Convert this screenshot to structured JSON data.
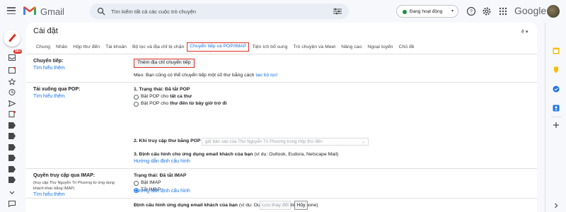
{
  "app": {
    "name": "Gmail",
    "search_placeholder": "Tìm kiếm tất cả các cuộc trò chuyện",
    "status": "Đang hoạt động",
    "account_brand": "Google",
    "inbox_badge": "99+"
  },
  "settings": {
    "title": "Cài đặt",
    "lang_icon": "ê",
    "tabs": [
      {
        "label": "Chung"
      },
      {
        "label": "Nhãn"
      },
      {
        "label": "Hộp thư đến"
      },
      {
        "label": "Tài khoản"
      },
      {
        "label": "Bộ lọc và địa chỉ bị chặn"
      },
      {
        "label": "Chuyển tiếp và POP/IMAP",
        "active": true
      },
      {
        "label": "Tiện ích bổ sung"
      },
      {
        "label": "Trò chuyện và Meet"
      },
      {
        "label": "Nâng cao"
      },
      {
        "label": "Ngoại tuyến"
      },
      {
        "label": "Chủ đề"
      }
    ],
    "forwarding": {
      "label": "Chuyển tiếp:",
      "learn_more": "Tìm hiểu thêm",
      "add_button": "Thêm địa chỉ chuyển tiếp",
      "tip_text": "Mẹo: Bạn cũng có thể chuyển tiếp một số thư bằng cách",
      "tip_link": "tạo bộ lọc!"
    },
    "pop": {
      "label": "Tải xuống qua POP:",
      "learn_more": "Tìm hiểu thêm",
      "status_title": "1. Trạng thái: Đã tắt POP",
      "option_all_prefix": "Bật POP cho ",
      "option_all_bold": "tất cả thư",
      "option_now_prefix": "Bật POP cho ",
      "option_now_bold": "thư đến từ bây giờ trở đi",
      "when_access_label": "2. Khi truy cập thư bằng POP",
      "when_access_value": "giữ bản sao của Thư Nguyễn Trí Phương trong Hộp thư đến",
      "configure_title": "3. Định cấu hình cho ứng dụng email khách của bạn",
      "configure_example": "(ví dụ: Outlook, Eudora, Netscape Mail)",
      "configure_link": "Hướng dẫn định cấu hình"
    },
    "imap": {
      "label": "Quyền truy cập qua IMAP:",
      "sub_line1": "(truy cập Thư Nguyễn Trí Phương từ ứng dụng",
      "sub_line2": "khách khác bằng IMAP)",
      "learn_more": "Tìm hiểu thêm",
      "status_title": "Trạng thái: Đã tắt IMAP",
      "option_enable": "Bật IMAP",
      "option_disable": "Tắt IMAP",
      "selected": "Tắt IMAP",
      "configure_title": "Định cấu hình ứng dụng email khách của bạn",
      "configure_example": "(ví dụ: Outlook, Thunderbird, iPhone)",
      "configure_link": "Hướng dẫn định cấu hình"
    },
    "footer": {
      "save": "Lưu thay đổi",
      "cancel": "Hủy"
    }
  },
  "colors": {
    "accent": "#1a73e8",
    "highlight_border": "#d93025",
    "status_green": "#1e8e3e"
  }
}
